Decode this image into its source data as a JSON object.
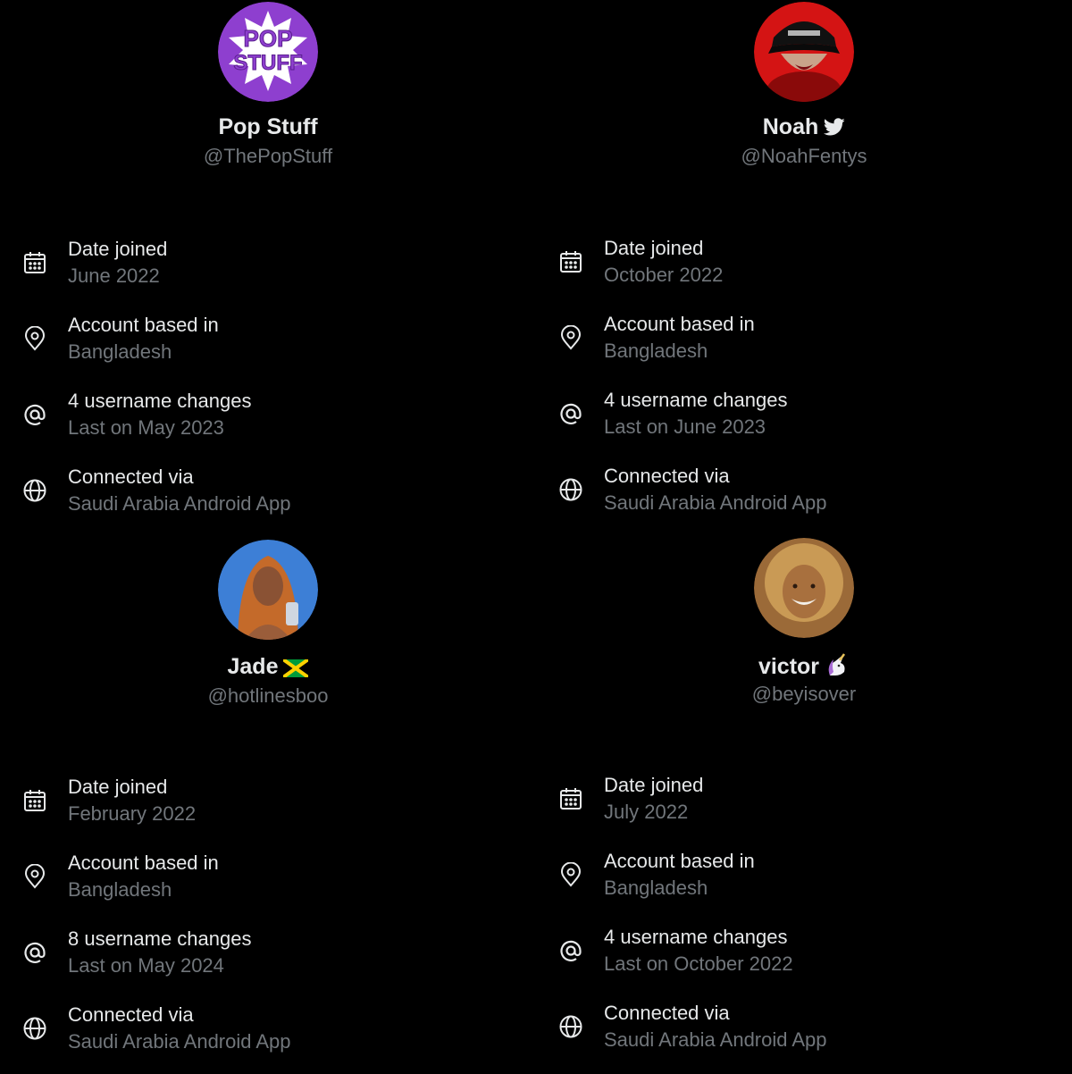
{
  "profiles": [
    {
      "name": "Pop Stuff",
      "handle": "@ThePopStuff",
      "logo_text": [
        "POP",
        "STUFF"
      ],
      "date_joined_label": "Date joined",
      "date_joined": "June 2022",
      "based_label": "Account based in",
      "based": "Bangladesh",
      "username_changes": "4 username changes",
      "username_last": "Last on May 2023",
      "connected_label": "Connected via",
      "connected": "Saudi Arabia Android App"
    },
    {
      "name": "Noah",
      "badge_icon": "bird-icon",
      "handle": "@NoahFentys",
      "date_joined_label": "Date joined",
      "date_joined": "October 2022",
      "based_label": "Account based in",
      "based": "Bangladesh",
      "username_changes": "4 username changes",
      "username_last": "Last on June 2023",
      "connected_label": "Connected via",
      "connected": "Saudi Arabia Android App"
    },
    {
      "name": "Jade",
      "badge_icon": "jamaica-flag-icon",
      "handle": "@hotlinesboo",
      "date_joined_label": "Date joined",
      "date_joined": "February 2022",
      "based_label": "Account based in",
      "based": "Bangladesh",
      "username_changes": "8 username changes",
      "username_last": "Last on May 2024",
      "connected_label": "Connected via",
      "connected": "Saudi Arabia Android App"
    },
    {
      "name": "victor",
      "badge_icon": "unicorn-icon",
      "handle": "@beyisover",
      "date_joined_label": "Date joined",
      "date_joined": "July 2022",
      "based_label": "Account based in",
      "based": "Bangladesh",
      "username_changes": "4 username changes",
      "username_last": "Last on October 2022",
      "connected_label": "Connected via",
      "connected": "Saudi Arabia Android App"
    }
  ],
  "colors": {
    "background": "#000000",
    "primary_text": "#e7e9ea",
    "secondary_text": "#71767b",
    "bird_badge": "#e7e9ea",
    "popstuff_purple": "#8e3fcf"
  }
}
